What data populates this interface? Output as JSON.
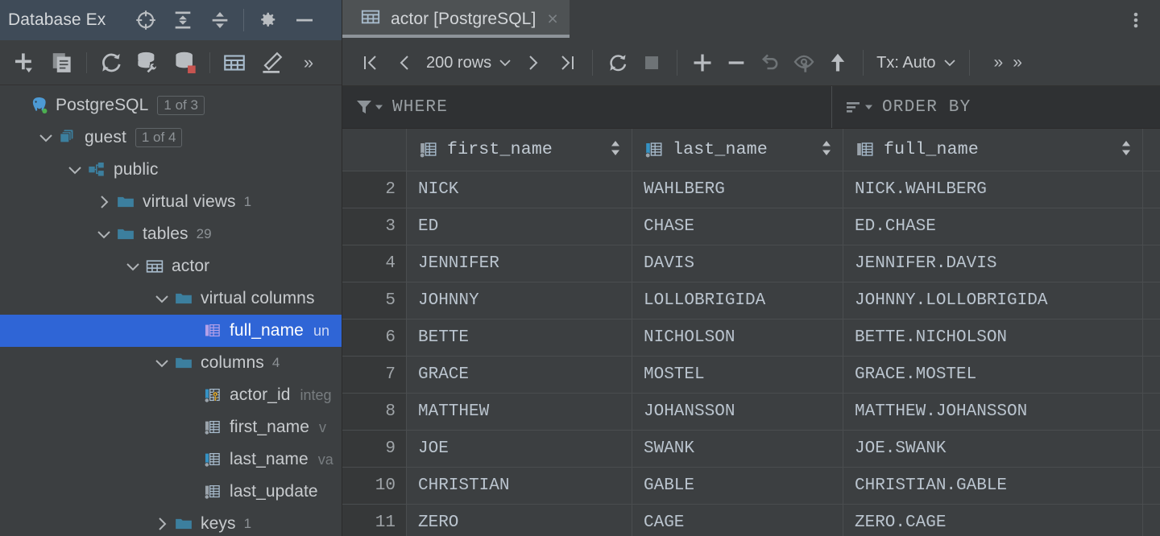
{
  "database_explorer": {
    "title": "Database Ex",
    "titlebar_icons": [
      {
        "name": "locate-icon",
        "label": "Select Opened File"
      },
      {
        "name": "expand-all-icon",
        "label": "Expand All"
      },
      {
        "name": "collapse-all-icon",
        "label": "Collapse All"
      },
      {
        "name": "gear-icon",
        "label": "Options"
      },
      {
        "name": "minimize-icon",
        "label": "Hide"
      }
    ],
    "toolbar_icons": [
      {
        "name": "add-icon",
        "label": "New"
      },
      {
        "name": "copy-icon",
        "label": "Duplicate"
      },
      {
        "name": "refresh-icon",
        "label": "Refresh"
      },
      {
        "name": "datasource-properties-icon",
        "label": "Data Source Properties"
      },
      {
        "name": "database-stop-icon",
        "label": "Disconnect"
      },
      {
        "name": "table-icon",
        "label": "Jump to Query Console"
      },
      {
        "name": "edit-data-icon",
        "label": "Modify Object"
      },
      {
        "name": "chevron-double-right-icon",
        "label": "More"
      }
    ],
    "tree": [
      {
        "name": "sidebar-item-postgresql",
        "indent": 0,
        "twisty": "none",
        "icon": "postgres-elephant-icon",
        "label": "PostgreSQL",
        "badge": "1 of 3",
        "count": "",
        "type": ""
      },
      {
        "name": "sidebar-item-guest",
        "indent": 1,
        "twisty": "down",
        "icon": "databases-group-icon",
        "label": "guest",
        "badge": "1 of 4",
        "count": "",
        "type": ""
      },
      {
        "name": "sidebar-item-public",
        "indent": 2,
        "twisty": "down",
        "icon": "schema-icon",
        "label": "public",
        "badge": "",
        "count": "",
        "type": ""
      },
      {
        "name": "sidebar-item-virtual-views",
        "indent": 3,
        "twisty": "right",
        "icon": "folder-icon",
        "label": "virtual views",
        "badge": "",
        "count": "1",
        "type": ""
      },
      {
        "name": "sidebar-item-tables",
        "indent": 3,
        "twisty": "down",
        "icon": "folder-icon",
        "label": "tables",
        "badge": "",
        "count": "29",
        "type": ""
      },
      {
        "name": "sidebar-item-actor",
        "indent": 4,
        "twisty": "down",
        "icon": "table-icon",
        "label": "actor",
        "badge": "",
        "count": "",
        "type": ""
      },
      {
        "name": "sidebar-item-virtual-columns",
        "indent": 5,
        "twisty": "down",
        "icon": "folder-icon",
        "label": "virtual columns",
        "badge": "",
        "count": "",
        "type": ""
      },
      {
        "name": "sidebar-item-full-name",
        "indent": 6,
        "twisty": "none",
        "icon": "virtual-column-icon",
        "label": "full_name",
        "badge": "",
        "count": "",
        "type": "un",
        "selected": true
      },
      {
        "name": "sidebar-item-columns",
        "indent": 5,
        "twisty": "down",
        "icon": "folder-icon",
        "label": "columns",
        "badge": "",
        "count": "4",
        "type": ""
      },
      {
        "name": "sidebar-item-actor-id",
        "indent": 6,
        "twisty": "none",
        "icon": "primary-key-column-icon",
        "label": "actor_id",
        "badge": "",
        "count": "",
        "type": "integ"
      },
      {
        "name": "sidebar-item-first-name",
        "indent": 6,
        "twisty": "none",
        "icon": "column-icon",
        "label": "first_name",
        "badge": "",
        "count": "",
        "type": "v"
      },
      {
        "name": "sidebar-item-last-name",
        "indent": 6,
        "twisty": "none",
        "icon": "indexed-column-icon",
        "label": "last_name",
        "badge": "",
        "count": "",
        "type": "va"
      },
      {
        "name": "sidebar-item-last-update",
        "indent": 6,
        "twisty": "none",
        "icon": "column-icon",
        "label": "last_update",
        "badge": "",
        "count": "",
        "type": ""
      },
      {
        "name": "sidebar-item-keys",
        "indent": 5,
        "twisty": "right",
        "icon": "folder-icon",
        "label": "keys",
        "badge": "",
        "count": "1",
        "type": ""
      }
    ]
  },
  "editor": {
    "tab": {
      "label": "actor [PostgreSQL]",
      "icon": "table-icon",
      "close": "×"
    },
    "kebab": "⋮",
    "toolbar": {
      "first_page": "|‹",
      "prev_page": "‹",
      "page_size": "200 rows",
      "page_size_caret": "∨",
      "next_page": "›",
      "last_page": "›|",
      "reload": "reload-icon",
      "stop": "stop-icon",
      "add_row": "add-row-icon",
      "delete_row": "delete-row-icon",
      "revert": "revert-icon",
      "preview_submit": "preview-changes-icon",
      "submit": "submit-icon",
      "tx_label": "Tx: Auto",
      "tx_caret": "∨",
      "overflow1": "»",
      "overflow2": "»"
    },
    "filter_bar": {
      "where_icon": "filter-icon",
      "where_label": "WHERE",
      "order_icon": "sort-icon",
      "order_label": "ORDER BY"
    }
  },
  "grid": {
    "columns": [
      {
        "name": "first_name",
        "icon": "column-icon",
        "sortable": true
      },
      {
        "name": "last_name",
        "icon": "indexed-column-icon",
        "sortable": true
      },
      {
        "name": "full_name",
        "icon": "virtual-column-icon",
        "sortable": true
      }
    ],
    "rows": [
      {
        "num": "2",
        "first_name": "NICK",
        "last_name": "WAHLBERG",
        "full_name": "NICK.WAHLBERG"
      },
      {
        "num": "3",
        "first_name": "ED",
        "last_name": "CHASE",
        "full_name": "ED.CHASE"
      },
      {
        "num": "4",
        "first_name": "JENNIFER",
        "last_name": "DAVIS",
        "full_name": "JENNIFER.DAVIS"
      },
      {
        "num": "5",
        "first_name": "JOHNNY",
        "last_name": "LOLLOBRIGIDA",
        "full_name": "JOHNNY.LOLLOBRIGIDA"
      },
      {
        "num": "6",
        "first_name": "BETTE",
        "last_name": "NICHOLSON",
        "full_name": "BETTE.NICHOLSON"
      },
      {
        "num": "7",
        "first_name": "GRACE",
        "last_name": "MOSTEL",
        "full_name": "GRACE.MOSTEL"
      },
      {
        "num": "8",
        "first_name": "MATTHEW",
        "last_name": "JOHANSSON",
        "full_name": "MATTHEW.JOHANSSON"
      },
      {
        "num": "9",
        "first_name": "JOE",
        "last_name": "SWANK",
        "full_name": "JOE.SWANK"
      },
      {
        "num": "10",
        "first_name": "CHRISTIAN",
        "last_name": "GABLE",
        "full_name": "CHRISTIAN.GABLE"
      },
      {
        "num": "11",
        "first_name": "ZERO",
        "last_name": "CAGE",
        "full_name": "ZERO.CAGE"
      }
    ]
  },
  "colors": {
    "titlebar_bg": "#3f4b58",
    "panel_bg": "#3c3f41",
    "filter_bg": "#2f3133",
    "selection_blue": "#2f65d6",
    "folder_teal": "#3c7f9e",
    "accent_red": "#c75450",
    "key_yellow": "#f0b429",
    "virtual_purple": "#b3a0e8",
    "indexed_blue": "#3592c4",
    "cell_text": "#bac4ce"
  }
}
